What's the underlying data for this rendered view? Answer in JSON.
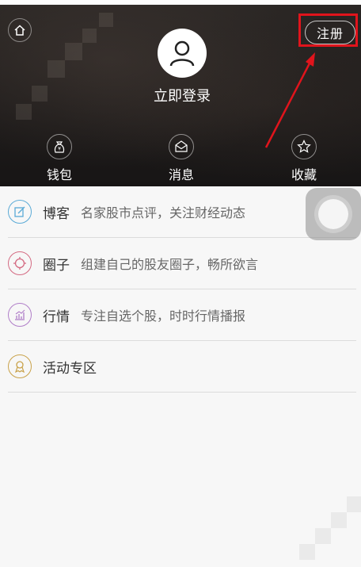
{
  "header": {
    "login_label": "立即登录",
    "register_label": "注册",
    "quick_actions": [
      {
        "label": "钱包",
        "icon": "wallet-icon"
      },
      {
        "label": "消息",
        "icon": "message-icon"
      },
      {
        "label": "收藏",
        "icon": "star-icon"
      }
    ],
    "annotation_color": "#e0141c"
  },
  "menu": [
    {
      "title": "博客",
      "desc": "名家股市点评，关注财经动态",
      "icon": "blog-edit-icon",
      "color": "#5aaad6"
    },
    {
      "title": "圈子",
      "desc": "组建自己的股友圈子，畅所欲言",
      "icon": "circle-target-icon",
      "color": "#d46a82"
    },
    {
      "title": "行情",
      "desc": "专注自选个股，时时行情播报",
      "icon": "market-chart-icon",
      "color": "#b07ec8"
    },
    {
      "title": "活动专区",
      "desc": "",
      "icon": "award-ribbon-icon",
      "color": "#c9a24a"
    }
  ]
}
